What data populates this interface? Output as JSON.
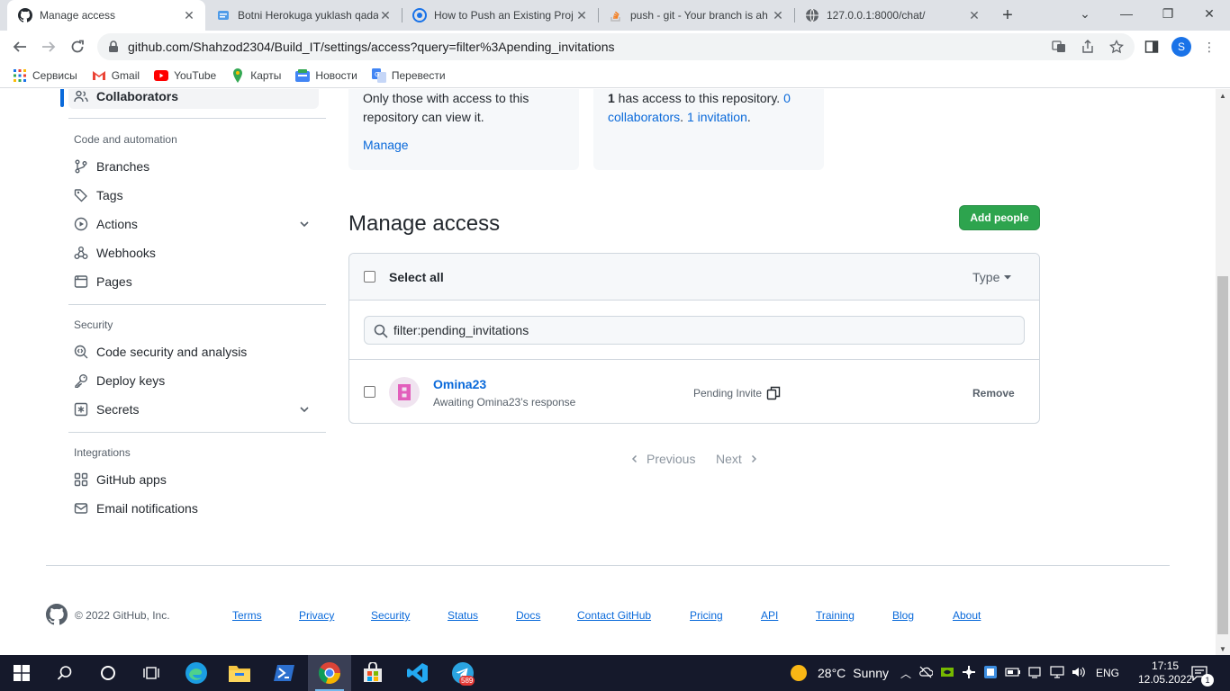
{
  "browser": {
    "tabs": [
      {
        "title": "Manage access",
        "active": true
      },
      {
        "title": "Botni Herokuga yuklash qada",
        "active": false
      },
      {
        "title": "How to Push an Existing Proj",
        "active": false
      },
      {
        "title": "push - git - Your branch is ah",
        "active": false
      },
      {
        "title": "127.0.0.1:8000/chat/",
        "active": false
      }
    ],
    "url": "github.com/Shahzod2304/Build_IT/settings/access?query=filter%3Apending_invitations",
    "profile_initial": "S",
    "bookmarks": [
      "Сервисы",
      "Gmail",
      "YouTube",
      "Карты",
      "Новости",
      "Перевести"
    ]
  },
  "sidebar": {
    "selected_item": "Collaborators",
    "sections": [
      {
        "heading": "Code and automation",
        "items": [
          "Branches",
          "Tags",
          "Actions",
          "Webhooks",
          "Pages"
        ]
      },
      {
        "heading": "Security",
        "items": [
          "Code security and analysis",
          "Deploy keys",
          "Secrets"
        ]
      },
      {
        "heading": "Integrations",
        "items": [
          "GitHub apps",
          "Email notifications"
        ]
      }
    ]
  },
  "cards": {
    "visibility": {
      "line1": "Only those with access to this",
      "line2": "repository can view it.",
      "manage_link": "Manage"
    },
    "access": {
      "count": "1",
      "text": " has access to this repository. ",
      "collab_link_a": "0",
      "collab_link_b": "collaborators",
      "sep": ". ",
      "invite_link": "1 invitation",
      "end": "."
    }
  },
  "manage": {
    "title": "Manage access",
    "add_button": "Add people",
    "select_all": "Select all",
    "type_filter": "Type",
    "filter_value": "filter:pending_invitations",
    "row": {
      "username": "Omina23",
      "status": "Awaiting Omina23’s response",
      "invite_label": "Pending Invite",
      "remove": "Remove"
    },
    "pager": {
      "previous": "Previous",
      "next": "Next"
    }
  },
  "footer": {
    "copyright": "© 2022 GitHub, Inc.",
    "links": [
      "Terms",
      "Privacy",
      "Security",
      "Status",
      "Docs",
      "Contact GitHub",
      "Pricing",
      "API",
      "Training",
      "Blog",
      "About"
    ]
  },
  "taskbar": {
    "weather_temp": "28°C",
    "weather_text": "Sunny",
    "lang": "ENG",
    "time": "17:15",
    "date": "12.05.2022",
    "telegram_badge": "589",
    "notif_count": "1"
  },
  "colors": {
    "accent": "#0969da",
    "success": "#2da44e",
    "chrome_bg": "#dee1e6",
    "taskbar": "#15192b"
  }
}
